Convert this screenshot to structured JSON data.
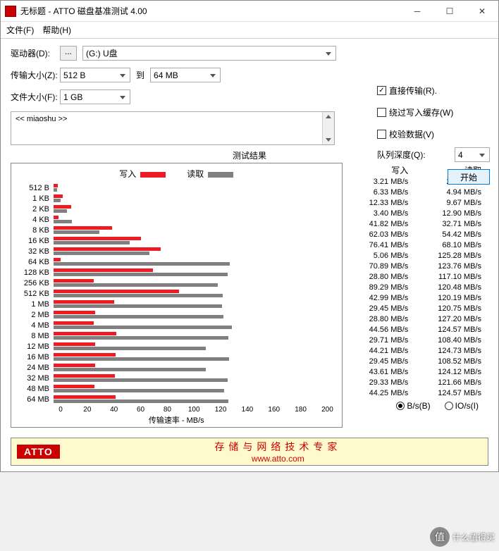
{
  "window": {
    "title": "无标题 - ATTO 磁盘基准测试 4.00"
  },
  "menu": {
    "file": "文件(F)",
    "help": "帮助(H)"
  },
  "labels": {
    "drive": "驱动器(D):",
    "transfer_size": "传输大小(Z):",
    "to": "到",
    "file_size": "文件大小(F):",
    "direct_io": "直接传输(R).",
    "bypass_cache": "绕过写入缓存(W)",
    "verify": "校验数据(V)",
    "queue_depth": "队列深度(Q):",
    "start": "开始",
    "results": "测试结果",
    "write": "写入",
    "read": "读取",
    "xaxis": "传输速率 - MB/s",
    "bs": "B/s(B)",
    "ios": "IO/s(I)"
  },
  "drive": {
    "value": "(G:) U盘"
  },
  "size_from": "512 B",
  "size_to": "64 MB",
  "file_size": "1 GB",
  "queue_depth": "4",
  "description": "<< miaoshu >>",
  "chart_data": {
    "type": "bar",
    "title": "测试结果",
    "xlabel": "传输速率 - MB/s",
    "xlim": [
      0,
      200
    ],
    "xticks": [
      0,
      20,
      40,
      60,
      80,
      100,
      120,
      140,
      160,
      180,
      200
    ],
    "categories": [
      "512 B",
      "1 KB",
      "2 KB",
      "4 KB",
      "8 KB",
      "16 KB",
      "32 KB",
      "64 KB",
      "128 KB",
      "256 KB",
      "512 KB",
      "1 MB",
      "2 MB",
      "4 MB",
      "8 MB",
      "12 MB",
      "16 MB",
      "24 MB",
      "32 MB",
      "48 MB",
      "64 MB"
    ],
    "series": [
      {
        "name": "写入",
        "color": "#ed1c24",
        "values": [
          3.21,
          6.33,
          12.33,
          3.4,
          41.82,
          62.03,
          76.41,
          5.06,
          70.89,
          28.8,
          89.29,
          42.99,
          29.45,
          28.8,
          44.56,
          29.71,
          44.21,
          29.45,
          43.61,
          29.33,
          44.25
        ]
      },
      {
        "name": "读取",
        "color": "#808080",
        "values": [
          2.52,
          4.94,
          9.67,
          12.9,
          32.71,
          54.42,
          68.1,
          125.28,
          123.76,
          117.1,
          120.48,
          120.19,
          120.75,
          127.2,
          124.57,
          108.4,
          124.73,
          108.52,
          124.12,
          121.66,
          124.57
        ]
      }
    ],
    "unit": "MB/s"
  },
  "footer": {
    "slogan": "存储与网络技术专家",
    "url": "www.atto.com"
  },
  "watermark": "什么值得买"
}
